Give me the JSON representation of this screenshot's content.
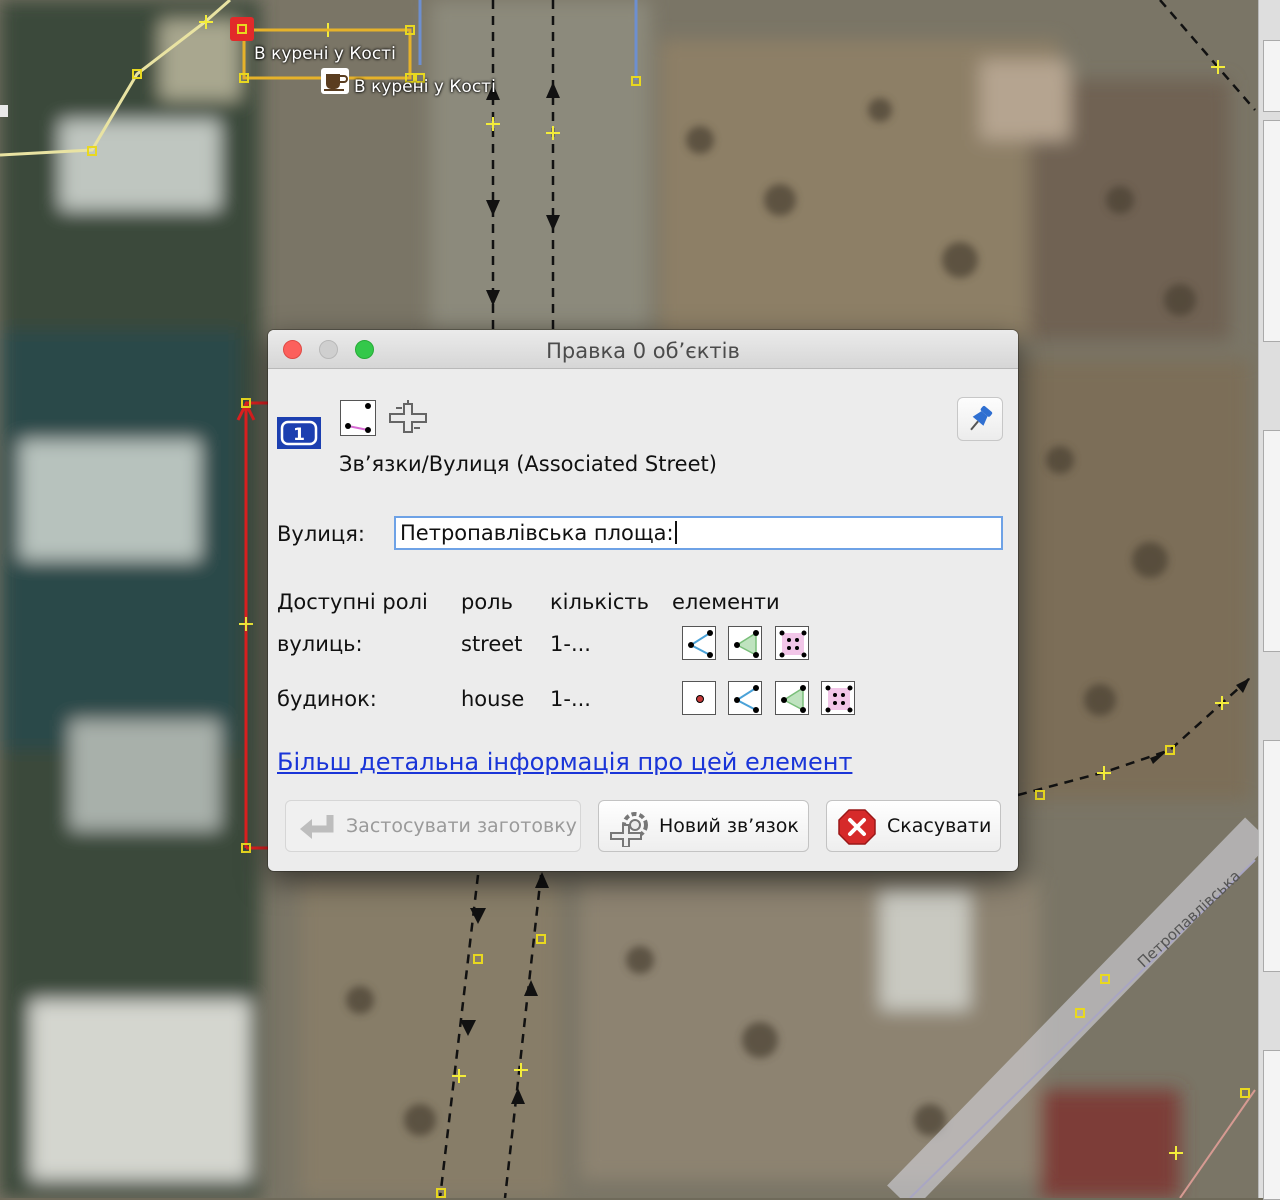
{
  "map": {
    "poi_label_top": "В курені у Кості",
    "poi_label_bottom": "В курені у Кості",
    "street_label": "Петропавлівська"
  },
  "dialog": {
    "title": "Правка 0 об’єктів",
    "preset_path": "Зв’язки/Вулиця (Associated Street)",
    "street_label": "Вулиця:",
    "street_value": "Петропавлівська площа:",
    "roles_header": {
      "available_roles": "Доступні ролі",
      "role": "роль",
      "count": "кількість",
      "elements": "елементи"
    },
    "roles": [
      {
        "name": "вулиць:",
        "role": "street",
        "count": "1-...",
        "icons": [
          "way-icon",
          "closed-way-icon",
          "multipolygon-icon"
        ]
      },
      {
        "name": "будинок:",
        "role": "house",
        "count": "1-...",
        "icons": [
          "node-icon",
          "way-icon",
          "closed-way-icon",
          "multipolygon-icon"
        ]
      }
    ],
    "more_info_link": "Більш детальна інформація про цей елемент",
    "buttons": {
      "apply_preset": "Застосувати заготовку",
      "new_relation": "Новий зв’язок",
      "cancel": "Скасувати"
    }
  }
}
